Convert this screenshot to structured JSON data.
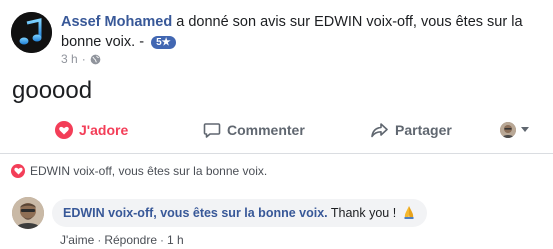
{
  "post": {
    "author": "Assef Mohamed",
    "action_text": "a donné son avis sur",
    "target": "EDWIN voix-off, vous êtes sur la bonne voix.",
    "separator": "-",
    "rating_badge": "5★",
    "time": "3 h",
    "dot": "·",
    "body": "gooood"
  },
  "actions": {
    "like_label": "J'adore",
    "comment_label": "Commenter",
    "share_label": "Partager"
  },
  "page_love": {
    "text": "EDWIN voix-off, vous êtes sur la bonne voix."
  },
  "comment": {
    "author": "EDWIN voix-off, vous êtes sur la bonne voix.",
    "text": "Thank you !",
    "like_label": "J'aime",
    "reply_label": "Répondre",
    "time": "1 h",
    "dot": "·"
  },
  "colors": {
    "link_blue": "#385898",
    "love_red": "#f33e58",
    "badge_blue": "#4267b2",
    "muted_gray": "#90949c",
    "bubble_bg": "#f2f3f5"
  },
  "icons": {
    "main_avatar": "music-note-icon",
    "like": "heart-icon",
    "comment": "speech-bubble-icon",
    "share": "share-arrow-icon",
    "privacy": "globe-icon",
    "emoji": "folded-hands-icon"
  }
}
